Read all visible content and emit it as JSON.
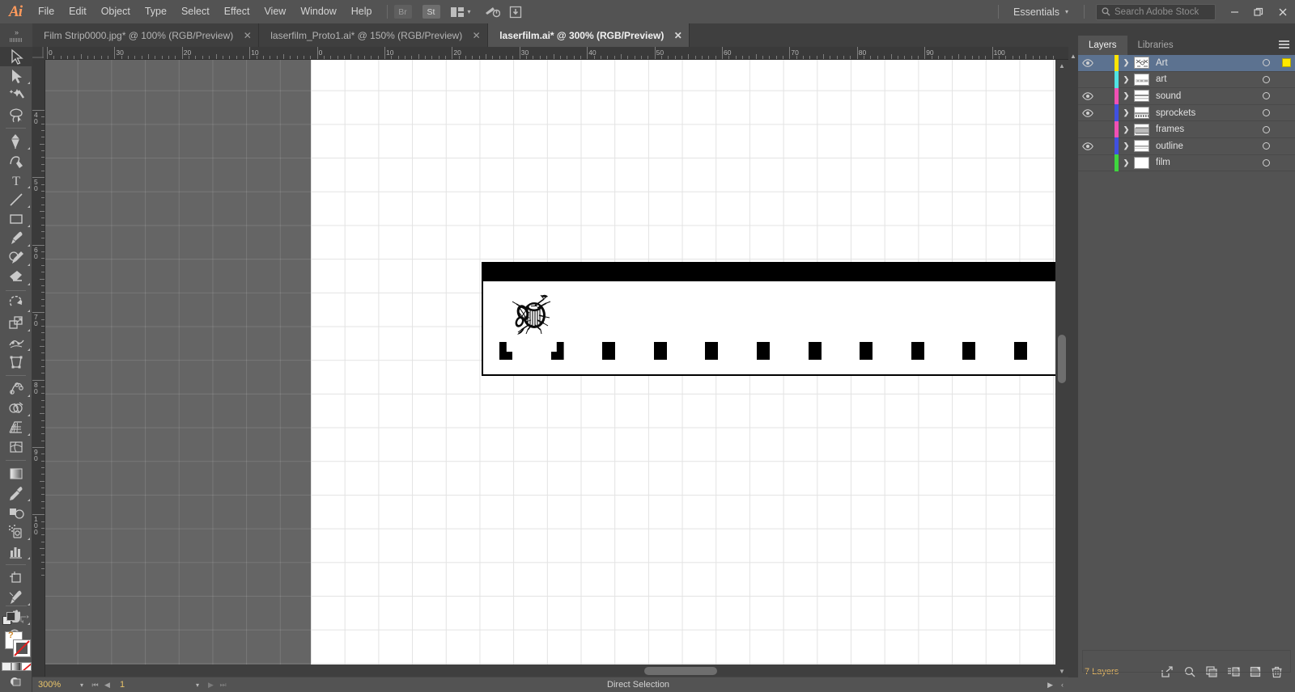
{
  "app": {
    "name": "Adobe Illustrator",
    "logo": "Ai"
  },
  "menubar": {
    "items": [
      "File",
      "Edit",
      "Object",
      "Type",
      "Select",
      "Effect",
      "View",
      "Window",
      "Help"
    ],
    "bridge_label": "Br",
    "stock_label": "St",
    "arrange_icon": "arrange-documents-icon",
    "icons": [
      "brush-sync-icon",
      "hand-stamp-icon"
    ],
    "workspace": {
      "label": "Essentials",
      "chevron": "⌄"
    },
    "search": {
      "placeholder": "Search Adobe Stock",
      "icon": "search-icon"
    },
    "window_buttons": {
      "minimize": "—",
      "restore": "❐",
      "close": "✕"
    }
  },
  "tabbar": {
    "dock_toggle": "»",
    "tabs": [
      {
        "label": "Film Strip0000.jpg* @ 100% (RGB/Preview)",
        "active": false,
        "close": "✕"
      },
      {
        "label": "laserfilm_Proto1.ai* @ 150% (RGB/Preview)",
        "active": false,
        "close": "✕"
      },
      {
        "label": "laserfilm.ai* @ 300% (RGB/Preview)",
        "active": true,
        "close": "✕"
      }
    ]
  },
  "toolbar": {
    "tools": [
      {
        "name": "selection-tool",
        "selected": true,
        "has_flyout": false
      },
      {
        "name": "direct-selection-tool",
        "selected": false,
        "has_flyout": true
      },
      {
        "name": "magic-wand-tool",
        "selected": false,
        "has_flyout": false
      },
      {
        "name": "lasso-tool",
        "selected": false,
        "has_flyout": false
      },
      {
        "name": "pen-tool",
        "selected": false,
        "has_flyout": true
      },
      {
        "name": "curvature-tool",
        "selected": false,
        "has_flyout": false
      },
      {
        "name": "type-tool",
        "selected": false,
        "has_flyout": true
      },
      {
        "name": "line-segment-tool",
        "selected": false,
        "has_flyout": true
      },
      {
        "name": "rectangle-tool",
        "selected": false,
        "has_flyout": true
      },
      {
        "name": "paintbrush-tool",
        "selected": false,
        "has_flyout": true
      },
      {
        "name": "shaper-pencil-tool",
        "selected": false,
        "has_flyout": true
      },
      {
        "name": "eraser-tool",
        "selected": false,
        "has_flyout": true
      },
      {
        "name": "rotate-tool",
        "selected": false,
        "has_flyout": true
      },
      {
        "name": "scale-tool",
        "selected": false,
        "has_flyout": true
      },
      {
        "name": "width-tool",
        "selected": false,
        "has_flyout": true
      },
      {
        "name": "free-transform-tool",
        "selected": false,
        "has_flyout": false
      },
      {
        "name": "puppet-warp-tool",
        "selected": false,
        "has_flyout": true
      },
      {
        "name": "shape-builder-tool",
        "selected": false,
        "has_flyout": true
      },
      {
        "name": "perspective-grid-tool",
        "selected": false,
        "has_flyout": true
      },
      {
        "name": "mesh-tool",
        "selected": false,
        "has_flyout": false
      },
      {
        "name": "gradient-tool",
        "selected": false,
        "has_flyout": false
      },
      {
        "name": "eyedropper-tool",
        "selected": false,
        "has_flyout": true
      },
      {
        "name": "blend-tool",
        "selected": false,
        "has_flyout": false
      },
      {
        "name": "symbol-sprayer-tool",
        "selected": false,
        "has_flyout": true
      },
      {
        "name": "column-graph-tool",
        "selected": false,
        "has_flyout": true
      },
      {
        "name": "artboard-tool",
        "selected": false,
        "has_flyout": false
      },
      {
        "name": "slice-tool",
        "selected": false,
        "has_flyout": true
      },
      {
        "name": "hand-tool",
        "selected": false,
        "has_flyout": true
      },
      {
        "name": "zoom-tool",
        "selected": false,
        "has_flyout": false
      }
    ],
    "fill_color": "#ffffff",
    "fill_marker": "?",
    "stroke_color": "none",
    "swap_icon": "swap-fill-stroke-icon",
    "default_icon": "default-fill-stroke-icon",
    "mode_buttons": [
      "color-swatch-button",
      "gradient-button",
      "none-button"
    ],
    "draw_mode_icon": "draw-normal-icon"
  },
  "rulers": {
    "units": "mm",
    "horizontal_labels": [
      "0",
      "30",
      "20",
      "10",
      "0",
      "10",
      "20",
      "30",
      "40",
      "50",
      "60",
      "70",
      "80",
      "90",
      "100"
    ],
    "vertical_labels": [
      "40",
      "50",
      "60",
      "70",
      "80",
      "90",
      "100"
    ]
  },
  "artwork": {
    "name": "film-strip-artwork",
    "description": "Film strip with black sound stripe, sprocket holes and engraved insect illustration",
    "sprocket_count": 12,
    "sprocket_color": "#000000",
    "strip_color": "#000000",
    "body_color": "#ffffff"
  },
  "statusbar": {
    "zoom": "300%",
    "zoom_chevron": "⌄",
    "nav_first": "⏮",
    "nav_prev": "◀",
    "artboard": "1",
    "artboard_chevron": "⌄",
    "nav_next": "▶",
    "nav_last": "⏭",
    "tool_name": "Direct Selection",
    "right_arrow": "▶",
    "right_chevron": "‹"
  },
  "panel": {
    "tabs": [
      {
        "label": "Layers",
        "active": true
      },
      {
        "label": "Libraries",
        "active": false
      }
    ],
    "menu_icon": "panel-menu-icon",
    "layers": [
      {
        "name": "Art",
        "visible": true,
        "locked": false,
        "color": "#ffe400",
        "selected": true,
        "thumb": "art-mixed-thumb",
        "has_appearance": true,
        "expand": "❯"
      },
      {
        "name": "art",
        "visible": false,
        "locked": false,
        "color": "#4fe3e3",
        "selected": false,
        "thumb": "lines-thumb",
        "has_appearance": false,
        "expand": "❯"
      },
      {
        "name": "sound",
        "visible": true,
        "locked": false,
        "color": "#f050b4",
        "selected": false,
        "thumb": "band-thumb",
        "has_appearance": false,
        "expand": "❯"
      },
      {
        "name": "sprockets",
        "visible": true,
        "locked": false,
        "color": "#4050e0",
        "selected": false,
        "thumb": "sprockets-thumb",
        "has_appearance": false,
        "expand": "❯"
      },
      {
        "name": "frames",
        "visible": false,
        "locked": false,
        "color": "#f050b4",
        "selected": false,
        "thumb": "frames-thumb",
        "has_appearance": false,
        "expand": "❯"
      },
      {
        "name": "outline",
        "visible": true,
        "locked": false,
        "color": "#4050e0",
        "selected": false,
        "thumb": "outline-thumb",
        "has_appearance": false,
        "expand": "❯"
      },
      {
        "name": "film",
        "visible": false,
        "locked": false,
        "color": "#3ed63e",
        "selected": false,
        "thumb": "blank-thumb",
        "has_appearance": false,
        "expand": "❯"
      }
    ],
    "footer": {
      "count_label": "7 Layers",
      "icons": [
        "locate-object-icon",
        "search-icon",
        "duplicate-layer-icon",
        "collect-in-new-layer-icon",
        "new-layer-icon",
        "delete-layer-icon"
      ]
    }
  },
  "colors": {
    "chrome": "#535353",
    "chrome_dark": "#3f3f3f",
    "canvas": "#656565",
    "accent_selected": "#5c7290",
    "text": "#d4d4d4",
    "value_text": "#e8c36a",
    "logo": "#ff9a5c"
  }
}
